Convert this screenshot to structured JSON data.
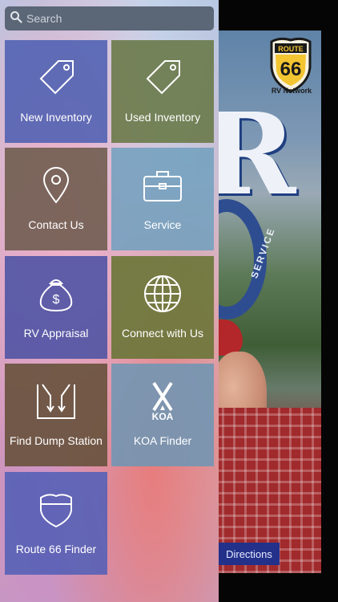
{
  "search": {
    "placeholder": "Search"
  },
  "tiles": [
    {
      "label": "New Inventory",
      "icon": "tag-icon",
      "color": "#4e60b2"
    },
    {
      "label": "Used Inventory",
      "icon": "tag-icon",
      "color": "#687846"
    },
    {
      "label": "Contact Us",
      "icon": "location-pin-icon",
      "color": "#705d50"
    },
    {
      "label": "Service",
      "icon": "toolbox-icon",
      "color": "#70a0be"
    },
    {
      "label": "RV Appraisal",
      "icon": "money-bag-icon",
      "color": "#5054a4"
    },
    {
      "label": "Connect with Us",
      "icon": "globe-icon",
      "color": "#6c763a"
    },
    {
      "label": "Find Dump Station",
      "icon": "dump-station-icon",
      "color": "#69523e"
    },
    {
      "label": "KOA Finder",
      "icon": "koa-icon",
      "color": "#7296b2"
    },
    {
      "label": "Route 66 Finder",
      "icon": "shield-icon",
      "color": "#5660b6"
    }
  ],
  "koa_wordmark": "KOA",
  "background": {
    "logo_top": "ROUTE",
    "logo_number": "66",
    "logo_caption": "RV Network",
    "service_text": "SERVICE",
    "directions_label": "Directions"
  }
}
